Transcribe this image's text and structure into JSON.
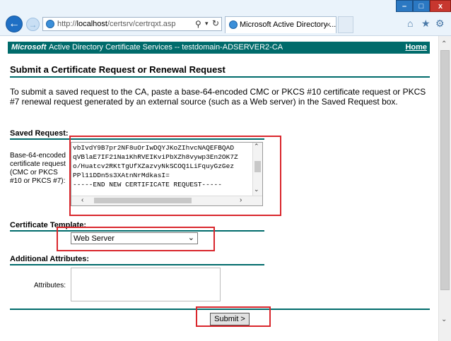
{
  "browser": {
    "url_prefix": "http://",
    "url_host": "localhost",
    "url_path": "/certsrv/certrqxt.asp",
    "tab_title": "Microsoft Active Directory ...",
    "window_buttons": {
      "minimize": "–",
      "maximize": "□",
      "close": "x"
    },
    "icons": [
      "back-arrow",
      "forward-arrow",
      "search",
      "refresh",
      "home",
      "star",
      "gear"
    ]
  },
  "header": {
    "brand": "Microsoft",
    "title": "Active Directory Certificate Services  --  testdomain-ADSERVER2-CA",
    "home_link": "Home"
  },
  "page": {
    "title": "Submit a Certificate Request or Renewal Request",
    "intro": "To submit a saved request to the CA, paste a base-64-encoded CMC or PKCS #10 certificate request or PKCS #7 renewal request generated by an external source (such as a Web server) in the Saved Request box."
  },
  "saved_request": {
    "section_label": "Saved Request:",
    "field_label": "Base-64-encoded certificate request (CMC or PKCS #10 or PKCS #7):",
    "lines": [
      "vbIvdY9B7pr2NF8uOrIwDQYJKoZIhvcNAQEFBQAD",
      "qVBlaE7IF21Na1KhRVEIKviPbXZh8vywp3En2OK7Z",
      "o/Huatcv2RKtTgUfXZazvyNkSCOQ1LiFquyGzGez",
      "PPl11DDn5s3XAtnNrMdkasI=",
      "-----END NEW CERTIFICATE REQUEST-----"
    ]
  },
  "certificate_template": {
    "section_label": "Certificate Template:",
    "selected": "Web Server"
  },
  "additional_attributes": {
    "section_label": "Additional Attributes:",
    "attributes_label": "Attributes:",
    "attributes_value": ""
  },
  "submit": {
    "label": "Submit >"
  },
  "colors": {
    "accent": "#006b6b",
    "highlight": "#d9262c"
  }
}
